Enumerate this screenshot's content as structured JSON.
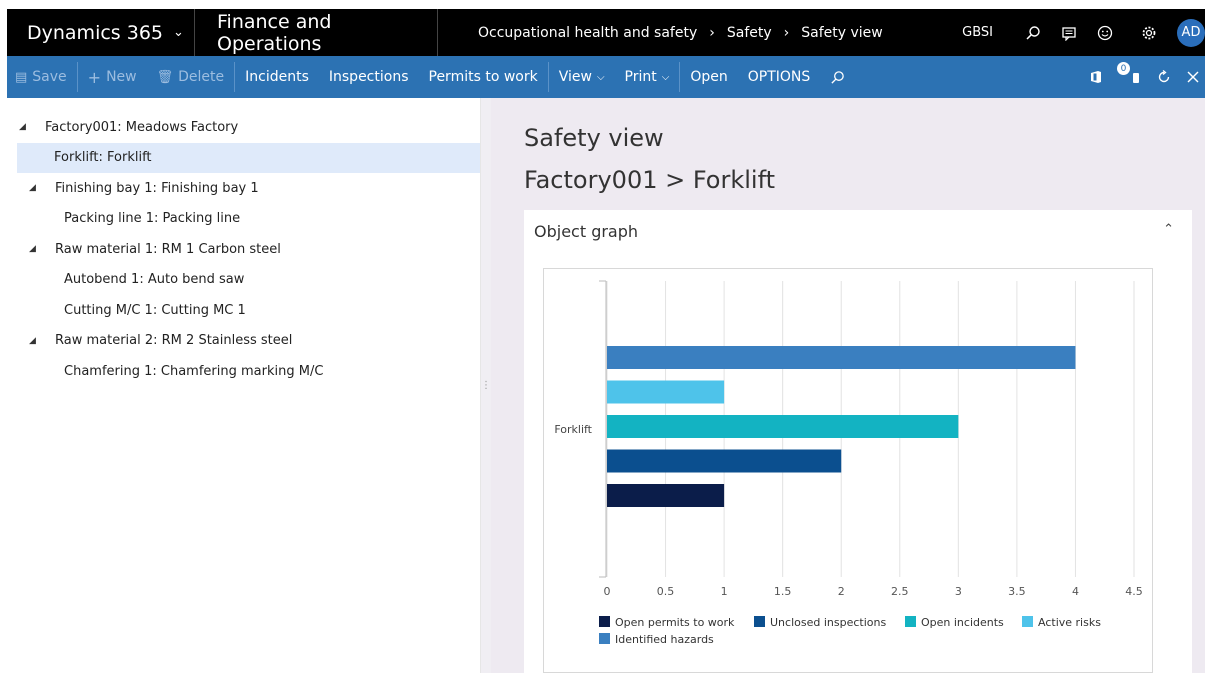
{
  "topbar": {
    "app_name": "Dynamics 365",
    "module": "Finance and Operations",
    "breadcrumbs": [
      "Occupational health and safety",
      "Safety",
      "Safety view"
    ],
    "company": "GBSI",
    "avatar_initials": "AD",
    "icons": [
      "search-icon",
      "chat-icon",
      "smiley-icon",
      "gear-icon"
    ]
  },
  "actionbar": {
    "save": "Save",
    "new": "New",
    "delete": "Delete",
    "incidents": "Incidents",
    "inspections": "Inspections",
    "permits": "Permits to work",
    "view": "View",
    "print": "Print",
    "open": "Open",
    "options": "OPTIONS",
    "notification_count": "0"
  },
  "tree": [
    {
      "label": "Factory001: Meadows Factory",
      "level": 0,
      "expander": true,
      "selected": false
    },
    {
      "label": "Forklift: Forklift",
      "level": 1,
      "expander": false,
      "selected": true
    },
    {
      "label": "Finishing bay 1: Finishing bay 1",
      "level": 1,
      "expander": true,
      "selected": false
    },
    {
      "label": "Packing line 1: Packing line",
      "level": 2,
      "expander": false,
      "selected": false
    },
    {
      "label": "Raw material 1: RM 1 Carbon steel",
      "level": 1,
      "expander": true,
      "selected": false
    },
    {
      "label": "Autobend 1: Auto bend saw",
      "level": 2,
      "expander": false,
      "selected": false
    },
    {
      "label": "Cutting M/C 1: Cutting MC 1",
      "level": 2,
      "expander": false,
      "selected": false
    },
    {
      "label": "Raw material 2: RM 2 Stainless steel",
      "level": 1,
      "expander": true,
      "selected": false
    },
    {
      "label": "Chamfering 1: Chamfering marking M/C",
      "level": 2,
      "expander": false,
      "selected": false
    }
  ],
  "content": {
    "title": "Safety view",
    "subtitle": "Factory001 > Forklift",
    "fasttab_title": "Object graph"
  },
  "chart_data": {
    "type": "bar",
    "orientation": "horizontal",
    "categories": [
      "Forklift"
    ],
    "series": [
      {
        "name": "Identified hazards",
        "values": [
          4
        ],
        "color": "#3a7fc0"
      },
      {
        "name": "Active risks",
        "values": [
          1
        ],
        "color": "#4ec3ea"
      },
      {
        "name": "Open incidents",
        "values": [
          3
        ],
        "color": "#13b3c2"
      },
      {
        "name": "Unclosed inspections",
        "values": [
          2
        ],
        "color": "#0b4f8f"
      },
      {
        "name": "Open permits to work",
        "values": [
          1
        ],
        "color": "#0b1d4a"
      }
    ],
    "legend_order": [
      "Open permits to work",
      "Unclosed inspections",
      "Open incidents",
      "Active risks",
      "Identified hazards"
    ],
    "xlim": [
      0,
      4.5
    ],
    "xticks": [
      "0",
      "0.5",
      "1",
      "1.5",
      "2",
      "2.5",
      "3",
      "3.5",
      "4",
      "4.5"
    ],
    "grid": true,
    "legend_position": "bottom"
  }
}
